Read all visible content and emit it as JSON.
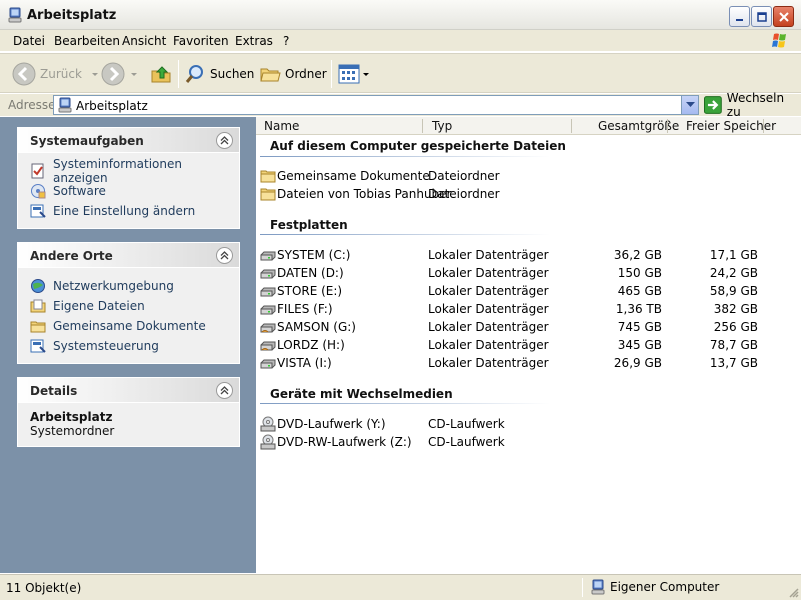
{
  "window": {
    "title": "Arbeitsplatz"
  },
  "menu": [
    "Datei",
    "Bearbeiten",
    "Ansicht",
    "Favoriten",
    "Extras",
    "?"
  ],
  "toolbar": {
    "back": "Zurück",
    "search": "Suchen",
    "folders": "Ordner"
  },
  "address": {
    "label": "Adresse",
    "value": "Arbeitsplatz",
    "go": "Wechseln zu"
  },
  "taskpane": {
    "system_tasks": {
      "title": "Systemaufgaben",
      "items": [
        "Systeminformationen anzeigen",
        "Software",
        "Eine Einstellung ändern"
      ]
    },
    "other_places": {
      "title": "Andere Orte",
      "items": [
        "Netzwerkumgebung",
        "Eigene Dateien",
        "Gemeinsame Dokumente",
        "Systemsteuerung"
      ]
    },
    "details": {
      "title": "Details",
      "name": "Arbeitsplatz",
      "type": "Systemordner"
    }
  },
  "columns": {
    "name": "Name",
    "type": "Typ",
    "total": "Gesamtgröße",
    "free": "Freier Speicher"
  },
  "groups": {
    "stored_files": {
      "title": "Auf diesem Computer gespeicherte Dateien",
      "items": [
        {
          "name": "Gemeinsame Dokumente",
          "type": "Dateiordner"
        },
        {
          "name": "Dateien von Tobias Panhuber",
          "type": "Dateiordner"
        }
      ]
    },
    "hard_disks": {
      "title": "Festplatten",
      "items": [
        {
          "name": "SYSTEM (C:)",
          "type": "Lokaler Datenträger",
          "total": "36,2 GB",
          "free": "17,1 GB"
        },
        {
          "name": "DATEN (D:)",
          "type": "Lokaler Datenträger",
          "total": "150 GB",
          "free": "24,2 GB"
        },
        {
          "name": "STORE (E:)",
          "type": "Lokaler Datenträger",
          "total": "465 GB",
          "free": "58,9 GB"
        },
        {
          "name": "FILES (F:)",
          "type": "Lokaler Datenträger",
          "total": "1,36 TB",
          "free": "382 GB"
        },
        {
          "name": "SAMSON (G:)",
          "type": "Lokaler Datenträger",
          "total": "745 GB",
          "free": "256 GB"
        },
        {
          "name": "LORDZ (H:)",
          "type": "Lokaler Datenträger",
          "total": "345 GB",
          "free": "78,7 GB"
        },
        {
          "name": "VISTA (I:)",
          "type": "Lokaler Datenträger",
          "total": "26,9 GB",
          "free": "13,7 GB"
        }
      ]
    },
    "removable": {
      "title": "Geräte mit Wechselmedien",
      "items": [
        {
          "name": "DVD-Laufwerk (Y:)",
          "type": "CD-Laufwerk"
        },
        {
          "name": "DVD-RW-Laufwerk (Z:)",
          "type": "CD-Laufwerk"
        }
      ]
    }
  },
  "status": {
    "count": "11 Objekt(e)",
    "zone": "Eigener Computer"
  }
}
